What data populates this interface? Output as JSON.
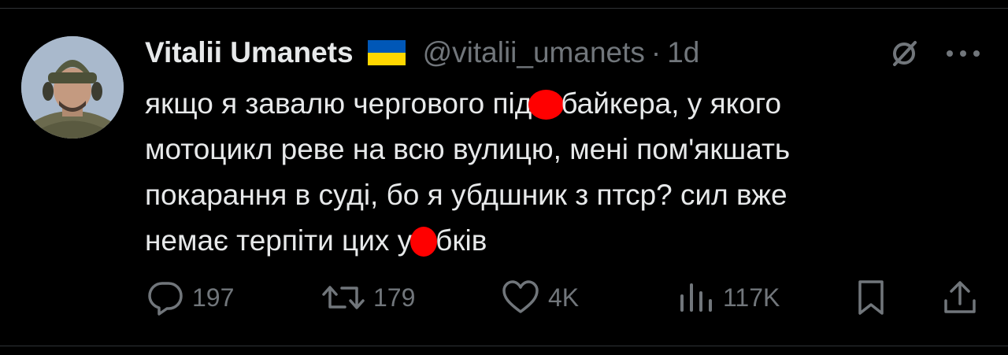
{
  "tweet": {
    "author_name": "Vitalii Umanets",
    "handle": "@vitalii_umanets",
    "separator": "·",
    "time": "1d",
    "lines": [
      [
        "якщо я завалю чергового під",
        "байкера, у якого"
      ],
      [
        "мотоцикл реве на всю вулицю, мені пом'якшать"
      ],
      [
        "покарання в суді, бо я убдшник з птср? сил вже"
      ],
      [
        "немає терпіти цих у",
        "бків"
      ]
    ]
  },
  "actions": {
    "replies": "197",
    "reposts": "179",
    "likes": "4K",
    "views": "117K"
  },
  "icons": {
    "flag": "ukraine-flag-icon",
    "grok": "grok-icon",
    "more": "more-icon",
    "reply": "reply-icon",
    "repost": "repost-icon",
    "like": "like-icon",
    "views": "views-icon",
    "bookmark": "bookmark-icon",
    "share": "share-icon"
  },
  "colors": {
    "background": "#000000",
    "text_primary": "#e7e9ea",
    "text_secondary": "#71767b",
    "censor_blot": "#ff0000",
    "flag_blue": "#0057b7",
    "flag_yellow": "#ffd700"
  }
}
